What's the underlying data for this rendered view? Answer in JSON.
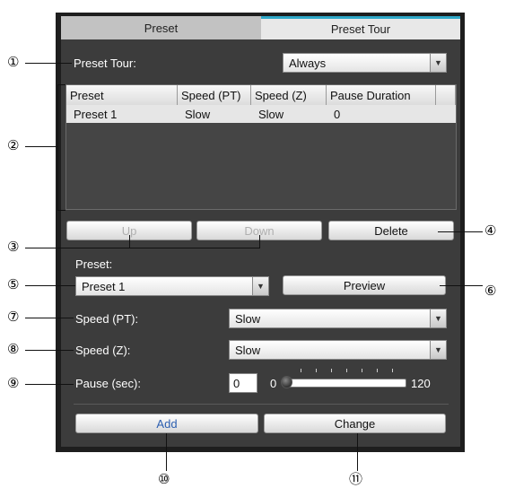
{
  "tabs": [
    {
      "label": "Preset"
    },
    {
      "label": "Preset Tour"
    }
  ],
  "preset_tour": {
    "label": "Preset Tour:",
    "value": "Always"
  },
  "table": {
    "columns": [
      "Preset",
      "Speed (PT)",
      "Speed (Z)",
      "Pause Duration"
    ],
    "rows": [
      {
        "preset": "Preset 1",
        "speed_pt": "Slow",
        "speed_z": "Slow",
        "pause": "0"
      }
    ]
  },
  "buttons": {
    "up": "Up",
    "down": "Down",
    "delete": "Delete",
    "preview": "Preview",
    "add": "Add",
    "change": "Change"
  },
  "preset": {
    "label": "Preset:",
    "value": "Preset 1"
  },
  "speed_pt": {
    "label": "Speed (PT):",
    "value": "Slow"
  },
  "speed_z": {
    "label": "Speed (Z):",
    "value": "Slow"
  },
  "pause": {
    "label": "Pause (sec):",
    "value": "0",
    "min": "0",
    "max": "120",
    "level": 0
  },
  "callouts": [
    "①",
    "②",
    "③",
    "④",
    "⑤",
    "⑥",
    "⑦",
    "⑧",
    "⑨",
    "⑩",
    "⑪"
  ],
  "colors": {
    "panel": "#1e1e1e",
    "content": "#3c3c3c",
    "tab_accent": "#2fa8c8",
    "add_text": "#2c5fb0"
  }
}
